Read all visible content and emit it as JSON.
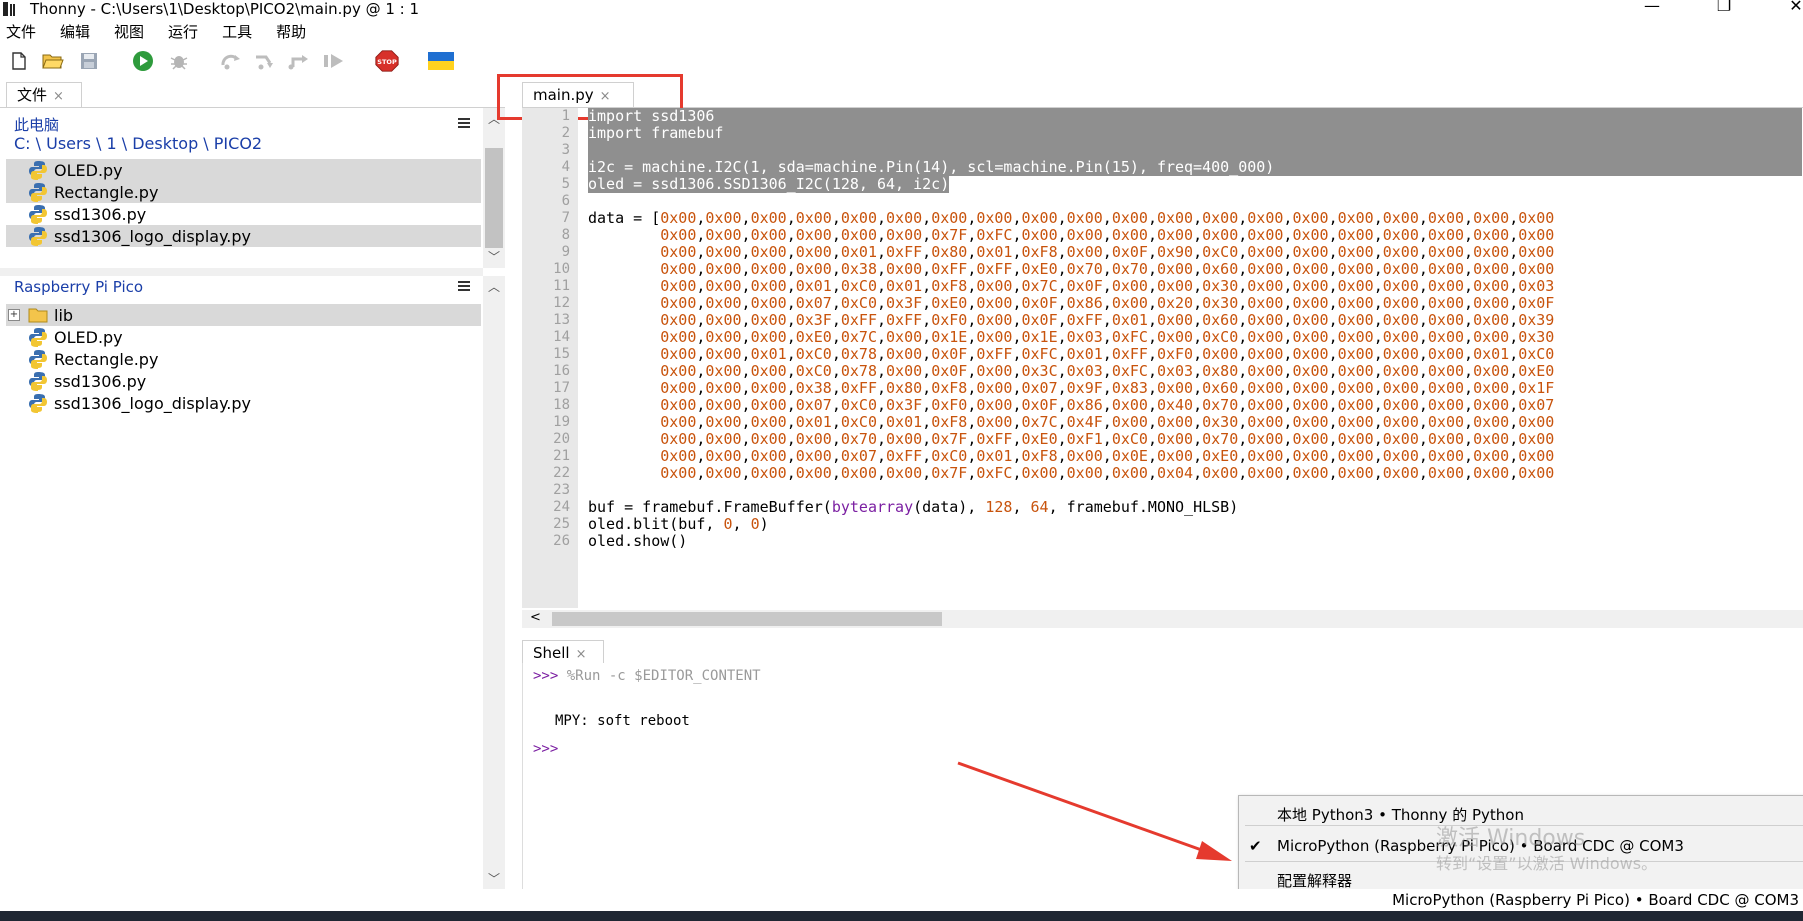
{
  "window": {
    "title": "Thonny  -  C:\\Users\\1\\Desktop\\PICO2\\main.py  @  1 : 1",
    "minimize": "—",
    "restore": "❐",
    "close": "✕"
  },
  "menu": [
    "文件",
    "编辑",
    "视图",
    "运行",
    "工具",
    "帮助"
  ],
  "toolbar": [
    "new-file",
    "open-file",
    "save-file",
    "run",
    "debug",
    "step-over",
    "step-into",
    "step-out",
    "resume",
    "stop",
    "ukraine-flag"
  ],
  "files": {
    "tab_label": "文件",
    "tab_close": "×",
    "computer": {
      "heading": "此电脑",
      "path": "C: \\ Users \\ 1 \\ Desktop \\ PICO2",
      "items": [
        {
          "name": "OLED.py",
          "selected": true
        },
        {
          "name": "Rectangle.py",
          "selected": true
        },
        {
          "name": "ssd1306.py",
          "selected": false
        },
        {
          "name": "ssd1306_logo_display.py",
          "selected": true
        }
      ]
    },
    "device": {
      "heading": "Raspberry Pi Pico",
      "folder": "lib",
      "expander": "+",
      "items": [
        "OLED.py",
        "Rectangle.py",
        "ssd1306.py",
        "ssd1306_logo_display.py"
      ]
    }
  },
  "editor": {
    "tab_label": "main.py",
    "tab_close": "×",
    "lines": [
      "import ssd1306",
      "import framebuf",
      "",
      "i2c = machine.I2C(1, sda=machine.Pin(14), scl=machine.Pin(15), freq=400_000)",
      "oled = ssd1306.SSD1306_I2C(128, 64, i2c)",
      "",
      "data = [0x00,0x00,0x00,0x00,0x00,0x00,0x00,0x00,0x00,0x00,0x00,0x00,0x00,0x00,0x00,0x00,0x00,0x00,0x00,0x00",
      "        0x00,0x00,0x00,0x00,0x00,0x00,0x7F,0xFC,0x00,0x00,0x00,0x00,0x00,0x00,0x00,0x00,0x00,0x00,0x00,0x00",
      "        0x00,0x00,0x00,0x00,0x01,0xFF,0x80,0x01,0xF8,0x00,0x0F,0x90,0xC0,0x00,0x00,0x00,0x00,0x00,0x00,0x00",
      "        0x00,0x00,0x00,0x00,0x38,0x00,0xFF,0xFF,0xE0,0x70,0x70,0x00,0x60,0x00,0x00,0x00,0x00,0x00,0x00,0x00",
      "        0x00,0x00,0x00,0x01,0xC0,0x01,0xF8,0x00,0x7C,0x0F,0x00,0x00,0x30,0x00,0x00,0x00,0x00,0x00,0x00,0x03",
      "        0x00,0x00,0x00,0x07,0xC0,0x3F,0xE0,0x00,0x0F,0x86,0x00,0x20,0x30,0x00,0x00,0x00,0x00,0x00,0x00,0x0F",
      "        0x00,0x00,0x00,0x3F,0xFF,0xFF,0xF0,0x00,0x0F,0xFF,0x01,0x00,0x60,0x00,0x00,0x00,0x00,0x00,0x00,0x39",
      "        0x00,0x00,0x00,0xE0,0x7C,0x00,0x1E,0x00,0x1E,0x03,0xFC,0x00,0xC0,0x00,0x00,0x00,0x00,0x00,0x00,0x30",
      "        0x00,0x00,0x01,0xC0,0x78,0x00,0x0F,0xFF,0xFC,0x01,0xFF,0xF0,0x00,0x00,0x00,0x00,0x00,0x00,0x01,0xC0",
      "        0x00,0x00,0x00,0xC0,0x78,0x00,0x0F,0x00,0x3C,0x03,0xFC,0x03,0x80,0x00,0x00,0x00,0x00,0x00,0x00,0xE0",
      "        0x00,0x00,0x00,0x38,0xFF,0x80,0xF8,0x00,0x07,0x9F,0x83,0x00,0x60,0x00,0x00,0x00,0x00,0x00,0x00,0x1F",
      "        0x00,0x00,0x00,0x07,0xC0,0x3F,0xF0,0x00,0x0F,0x86,0x00,0x40,0x70,0x00,0x00,0x00,0x00,0x00,0x00,0x07",
      "        0x00,0x00,0x00,0x01,0xC0,0x01,0xF8,0x00,0x7C,0x4F,0x00,0x00,0x30,0x00,0x00,0x00,0x00,0x00,0x00,0x00",
      "        0x00,0x00,0x00,0x00,0x70,0x00,0x7F,0xFF,0xE0,0xF1,0xC0,0x00,0x70,0x00,0x00,0x00,0x00,0x00,0x00,0x00",
      "        0x00,0x00,0x00,0x00,0x07,0xFF,0xC0,0x01,0xF8,0x00,0x0E,0x00,0xE0,0x00,0x00,0x00,0x00,0x00,0x00,0x00",
      "        0x00,0x00,0x00,0x00,0x00,0x00,0x7F,0xFC,0x00,0x00,0x00,0x04,0x00,0x00,0x00,0x00,0x00,0x00,0x00,0x00",
      "",
      "buf = framebuf.FrameBuffer(bytearray(data), 128, 64, framebuf.MONO_HLSB)",
      "oled.blit(buf, 0, 0)",
      "oled.show()"
    ],
    "selected_lines": [
      1,
      2,
      3,
      4,
      5
    ],
    "scroll_left_arrow": "<"
  },
  "shell": {
    "tab_label": "Shell",
    "tab_close": "×",
    "prompt": ">>>",
    "command": "%Run -c $EDITOR_CONTENT",
    "output": "MPY: soft reboot"
  },
  "interpreter_menu": {
    "items": [
      {
        "label": "本地 Python3  •  Thonny 的 Python",
        "checked": false
      },
      {
        "label": "MicroPython (Raspberry Pi Pico)  •  Board CDC @ COM3",
        "checked": true
      },
      {
        "label": "配置解释器",
        "checked": false
      }
    ],
    "checkmark": "✔"
  },
  "watermark": {
    "line1": "激活 Windows",
    "line2": "转到“设置”以激活 Windows。"
  },
  "status": {
    "interpreter": "MicroPython (Raspberry Pi Pico)  •  Board CDC @ COM3"
  },
  "colors": {
    "selection": "#8f8f8f",
    "number": "#c8530c",
    "prompt": "#7b1fa2",
    "annotation": "#e53a2e",
    "link": "#1a3ea8"
  }
}
